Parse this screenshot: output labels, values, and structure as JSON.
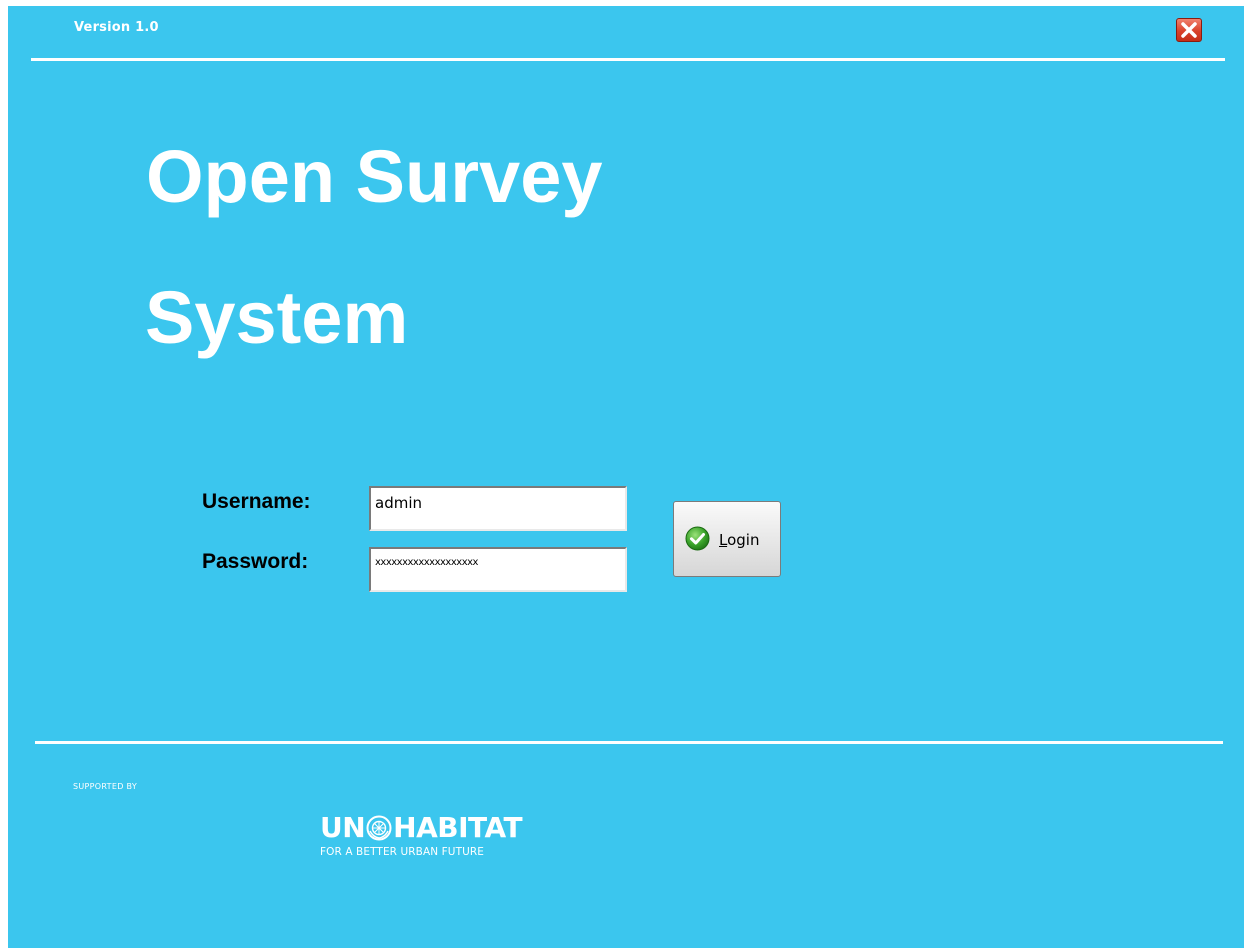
{
  "header": {
    "version": "Version 1.0"
  },
  "title": {
    "line1": "Open Survey",
    "line2": "System"
  },
  "form": {
    "username_label": "Username:",
    "username_value": "admin",
    "password_label": "Password:",
    "password_value": "xxxxxxxxxxxxxxxxxxx",
    "login_label": "Login"
  },
  "footer": {
    "supported_by": "SUPPORTED BY",
    "logo_name_part1": "UN",
    "logo_name_part2": "HABITAT",
    "logo_tagline": "FOR A BETTER URBAN FUTURE"
  },
  "icons": {
    "close": "close-icon",
    "login": "checkmark-icon",
    "emblem": "un-emblem-icon"
  },
  "colors": {
    "background": "#3bc6ee",
    "text_light": "#ffffff",
    "close_button": "#d9412a",
    "checkmark": "#3aa32a"
  }
}
